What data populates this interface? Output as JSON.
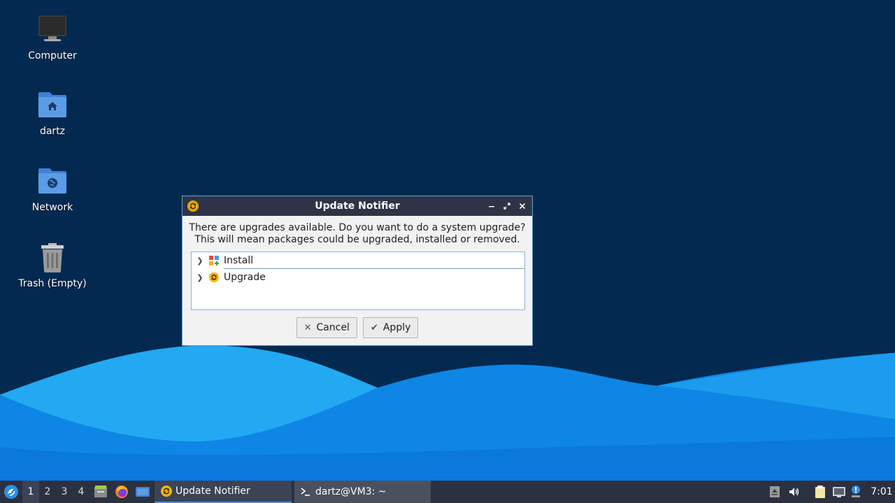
{
  "desktop": {
    "icons": [
      {
        "label": "Computer"
      },
      {
        "label": "dartz"
      },
      {
        "label": "Network"
      },
      {
        "label": "Trash (Empty)"
      }
    ]
  },
  "dialog": {
    "title": "Update Notifier",
    "message_line1": "There are upgrades available. Do you want to do a system upgrade?",
    "message_line2": "This will mean packages could be upgraded, installed or removed.",
    "tree": [
      {
        "label": "Install",
        "icon": "install-icon"
      },
      {
        "label": "Upgrade",
        "icon": "upgrade-icon"
      }
    ],
    "cancel_label": "Cancel",
    "apply_label": "Apply"
  },
  "taskbar": {
    "workspaces": [
      "1",
      "2",
      "3",
      "4"
    ],
    "active_workspace": "1",
    "tasks": [
      {
        "label": "Update Notifier",
        "icon": "update-notifier-icon",
        "active": true
      },
      {
        "label": "dartz@VM3: ~",
        "icon": "terminal-icon",
        "active": false
      }
    ],
    "clock": "7:01"
  },
  "colors": {
    "desktop_bg": "#022a50",
    "wave_light": "#1aa3f0",
    "wave_dark": "#0a6fd6",
    "titlebar": "#2d3446",
    "taskbar": "#2b3140",
    "accent": "#4b8fdd"
  }
}
